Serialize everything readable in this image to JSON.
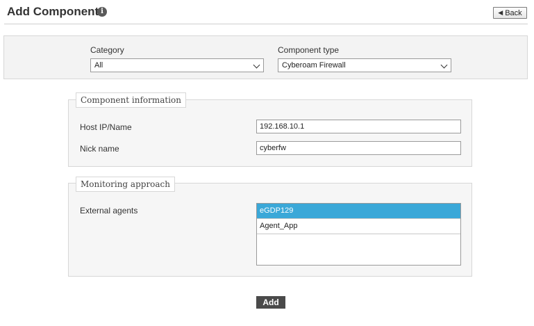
{
  "header": {
    "title": "Add Component",
    "info_icon": "info-icon",
    "back_label": "Back",
    "back_icon": "back-arrow-icon"
  },
  "filters": {
    "category_label": "Category",
    "category_value": "All",
    "component_type_label": "Component type",
    "component_type_value": "Cyberoam Firewall"
  },
  "component_information": {
    "legend": "Component information",
    "host_label": "Host IP/Name",
    "host_value": "192.168.10.1",
    "nick_label": "Nick name",
    "nick_value": "cyberfw"
  },
  "monitoring_approach": {
    "legend": "Monitoring approach",
    "agents_label": "External agents",
    "agents": [
      {
        "label": "eGDP129",
        "selected": true
      },
      {
        "label": "Agent_App",
        "selected": false
      }
    ]
  },
  "actions": {
    "add_label": "Add"
  },
  "colors": {
    "selected_row": "#3aa8d8",
    "add_button": "#4a4a4a",
    "panel_bg": "#f3f3f3"
  }
}
